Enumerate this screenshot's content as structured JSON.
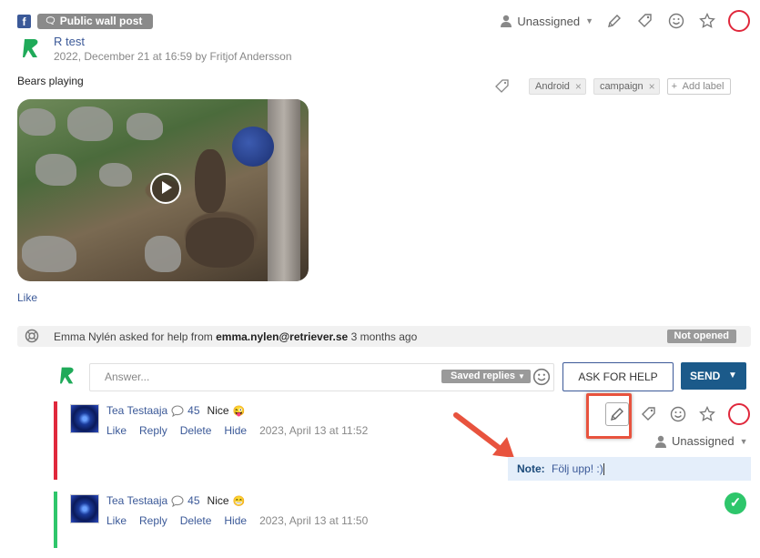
{
  "post": {
    "source_icon": "facebook-icon",
    "type_badge": "Public wall post",
    "page_name": "R test",
    "meta": "2022, December 21 at 16:59 by Fritjof Andersson",
    "text": "Bears playing",
    "like_label": "Like",
    "assignee": "Unassigned",
    "labels": [
      "Android",
      "campaign"
    ],
    "add_label": "Add label"
  },
  "help": {
    "requester": "Emma Nylén",
    "middle": "asked for help from",
    "email": "emma.nylen@retriever.se",
    "time": "3 months ago",
    "status": "Not opened"
  },
  "reply_box": {
    "placeholder": "Answer...",
    "saved_replies": "Saved replies",
    "ask_for_help": "ASK FOR HELP",
    "send": "SEND"
  },
  "comments": [
    {
      "author": "Tea Testaaja",
      "count": "45",
      "text": "Nice",
      "emoji": "😜",
      "actions": [
        "Like",
        "Reply",
        "Delete",
        "Hide"
      ],
      "time": "2023, April 13 at 11:52",
      "assignee": "Unassigned",
      "note_label": "Note:",
      "note_text": "Följ upp! :)",
      "status_color": "#e0283c"
    },
    {
      "author": "Tea Testaaja",
      "count": "45",
      "text": "Nice",
      "emoji": "😁",
      "actions": [
        "Like",
        "Reply",
        "Delete",
        "Hide"
      ],
      "time": "2023, April 13 at 11:50",
      "status_color": "#2ec66b"
    }
  ],
  "colors": {
    "accent": "#3b5998",
    "send": "#1b5a8a",
    "unhandled": "#e0283c",
    "handled": "#2ec66b",
    "annotation": "#e8533e"
  }
}
